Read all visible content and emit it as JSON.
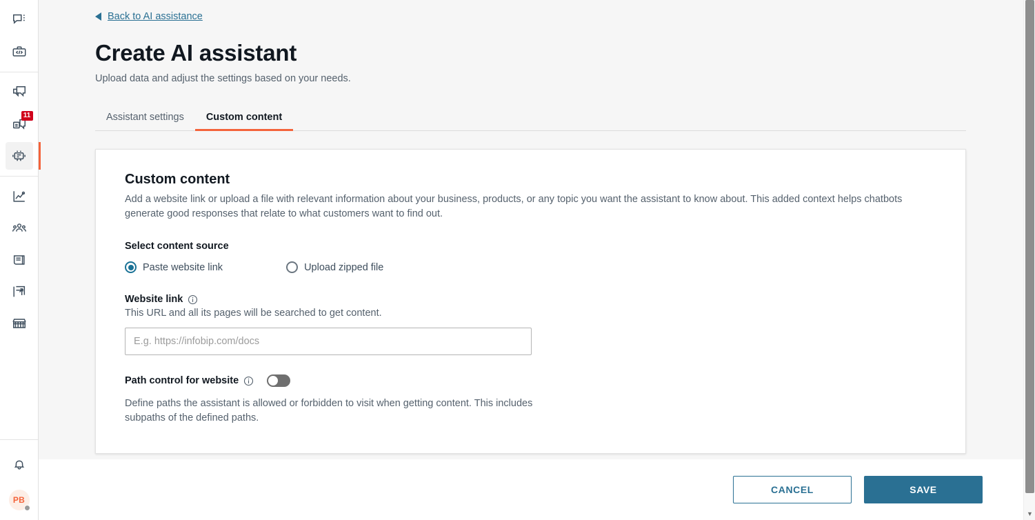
{
  "colors": {
    "accent_orange": "#f4633a",
    "link_blue": "#2a7093",
    "primary_button": "#2a7093",
    "badge_red": "#d0021b",
    "radio_selected": "#1a7296",
    "page_background": "#f6f6f6"
  },
  "sidebar": {
    "groups": [
      {
        "items": [
          {
            "icon": "chat-menu-icon",
            "name": "sidebar-item-conversations",
            "badge": null,
            "active": false
          },
          {
            "icon": "developer-tools-icon",
            "name": "sidebar-item-developer-tools",
            "badge": null,
            "active": false
          }
        ]
      },
      {
        "items": [
          {
            "icon": "multi-chat-icon",
            "name": "sidebar-item-messaging",
            "badge": null,
            "active": false
          },
          {
            "icon": "inbox-chat-icon",
            "name": "sidebar-item-inbox",
            "badge": "11",
            "active": false
          },
          {
            "icon": "robot-icon",
            "name": "sidebar-item-ai-assistance",
            "badge": null,
            "active": true
          }
        ]
      },
      {
        "items": [
          {
            "icon": "analytics-chart-icon",
            "name": "sidebar-item-analytics",
            "badge": null,
            "active": false
          },
          {
            "icon": "people-icon",
            "name": "sidebar-item-audience",
            "badge": null,
            "active": false
          },
          {
            "icon": "document-icon",
            "name": "sidebar-item-content",
            "badge": null,
            "active": false
          },
          {
            "icon": "flow-arrow-icon",
            "name": "sidebar-item-flows",
            "badge": null,
            "active": false
          },
          {
            "icon": "storefront-icon",
            "name": "sidebar-item-marketplace",
            "badge": null,
            "active": false
          }
        ]
      }
    ],
    "bottom": {
      "notifications_icon": "bell-icon",
      "avatar_initials": "PB"
    }
  },
  "header": {
    "back_link": "Back to AI assistance",
    "title": "Create AI assistant",
    "subtitle": "Upload data and adjust the settings based on your needs."
  },
  "tabs": [
    {
      "label": "Assistant settings",
      "active": false
    },
    {
      "label": "Custom content",
      "active": true
    }
  ],
  "card": {
    "title": "Custom content",
    "description": "Add a website link or upload a file with relevant information about your business, products, or any topic you want the assistant to know about. This added context helps chatbots generate good responses that relate to what customers want to find out.",
    "content_source": {
      "label": "Select content source",
      "options": [
        {
          "label": "Paste website link",
          "selected": true
        },
        {
          "label": "Upload zipped file",
          "selected": false
        }
      ]
    },
    "website_link": {
      "label": "Website link",
      "help": "This URL and all its pages will be searched to get content.",
      "placeholder": "E.g. https://infobip.com/docs",
      "value": ""
    },
    "path_control": {
      "label": "Path control for website",
      "enabled": false,
      "description": "Define paths the assistant is allowed or forbidden to visit when getting content. This includes subpaths of the defined paths."
    }
  },
  "footer": {
    "cancel_label": "CANCEL",
    "save_label": "SAVE"
  },
  "scrollbar": {
    "down_arrow_glyph": "▼"
  }
}
